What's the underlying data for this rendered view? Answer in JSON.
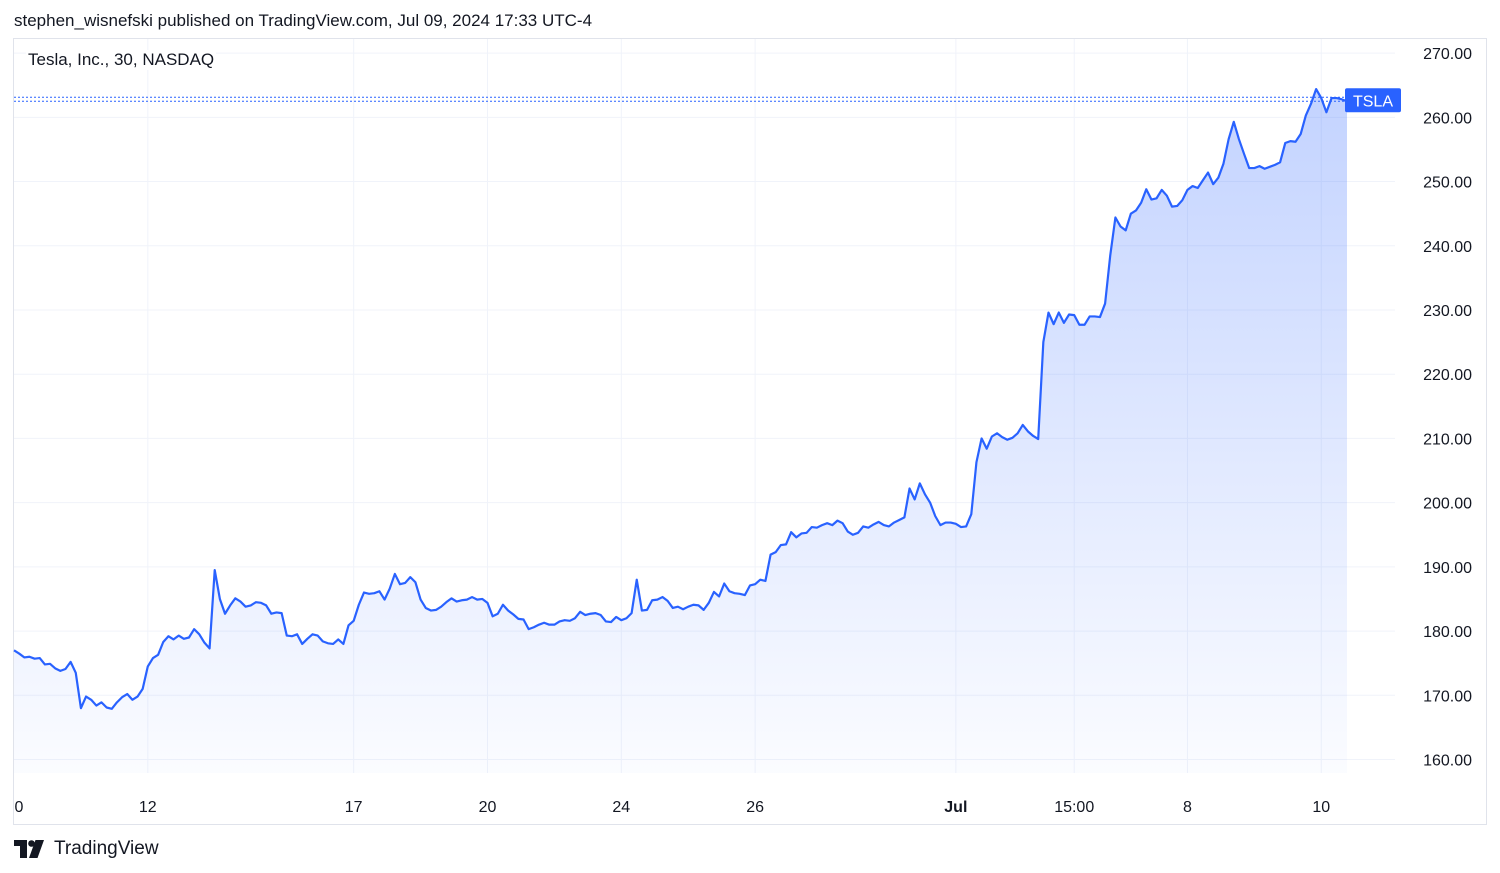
{
  "header": {
    "publish_text": "stephen_wisnefski published on TradingView.com, Jul 09, 2024 17:33 UTC-4"
  },
  "footer": {
    "brand": "TradingView"
  },
  "colors": {
    "line": "#2962ff",
    "fill_top": "#2962ff",
    "grid": "#f0f3fa",
    "badge": "#2962ff"
  },
  "chart_data": {
    "type": "area",
    "title": "Tesla, Inc., 30, NASDAQ",
    "series": [
      {
        "name": "TSLA"
      }
    ],
    "last_label": "TSLA",
    "grid": true,
    "y_axis_position": "right",
    "ylim": [
      157.9,
      272.2
    ],
    "y_ticks": [
      160,
      170,
      180,
      190,
      200,
      210,
      220,
      230,
      240,
      250,
      260,
      270
    ],
    "y_tick_labels": [
      "160.00",
      "170.00",
      "180.00",
      "190.00",
      "200.00",
      "210.00",
      "220.00",
      "230.00",
      "240.00",
      "250.00",
      "260.00",
      "270.00"
    ],
    "x_ticks": [
      {
        "index": 0,
        "label": "0"
      },
      {
        "index": 26,
        "label": "12"
      },
      {
        "index": 66,
        "label": "17"
      },
      {
        "index": 92,
        "label": "20"
      },
      {
        "index": 118,
        "label": "24"
      },
      {
        "index": 144,
        "label": "26"
      },
      {
        "index": 183,
        "label": "Jul",
        "bold": true
      },
      {
        "index": 206,
        "label": "15:00"
      },
      {
        "index": 228,
        "label": "8"
      },
      {
        "index": 254,
        "label": "10"
      }
    ],
    "values": [
      177.0,
      176.5,
      175.9,
      176.0,
      175.7,
      175.8,
      174.8,
      174.9,
      174.2,
      173.8,
      174.1,
      175.2,
      173.5,
      168.0,
      169.8,
      169.3,
      168.4,
      168.9,
      168.1,
      167.9,
      168.9,
      169.7,
      170.2,
      169.3,
      169.8,
      171.0,
      174.5,
      175.8,
      176.3,
      178.3,
      179.2,
      178.7,
      179.3,
      178.8,
      179.0,
      180.3,
      179.5,
      178.2,
      177.3,
      189.5,
      185.0,
      182.7,
      184.0,
      185.1,
      184.6,
      183.8,
      184.0,
      184.5,
      184.4,
      184.0,
      182.7,
      182.9,
      182.8,
      179.3,
      179.2,
      179.5,
      178.0,
      178.8,
      179.5,
      179.3,
      178.4,
      178.1,
      178.0,
      178.7,
      178.0,
      180.9,
      181.6,
      184.1,
      186.0,
      185.8,
      185.9,
      186.2,
      184.9,
      186.6,
      188.9,
      187.3,
      187.5,
      188.4,
      187.6,
      184.9,
      183.6,
      183.2,
      183.3,
      183.8,
      184.5,
      185.1,
      184.6,
      184.8,
      184.9,
      185.3,
      184.9,
      185.0,
      184.4,
      182.3,
      182.7,
      184.1,
      183.2,
      182.6,
      181.9,
      181.8,
      180.3,
      180.6,
      181.0,
      181.3,
      181.0,
      181.0,
      181.5,
      181.7,
      181.6,
      182.0,
      183.0,
      182.5,
      182.7,
      182.8,
      182.5,
      181.5,
      181.4,
      182.2,
      181.7,
      182.0,
      182.8,
      188.0,
      183.2,
      183.3,
      184.8,
      184.9,
      185.3,
      184.7,
      183.6,
      183.8,
      183.4,
      183.8,
      184.1,
      184.0,
      183.3,
      184.4,
      186.1,
      185.4,
      187.4,
      186.2,
      185.9,
      185.8,
      185.6,
      187.1,
      187.3,
      188.0,
      187.8,
      191.9,
      192.3,
      193.4,
      193.5,
      195.4,
      194.6,
      195.2,
      195.3,
      196.2,
      196.1,
      196.5,
      196.8,
      196.5,
      197.2,
      196.8,
      195.5,
      195.0,
      195.3,
      196.3,
      196.1,
      196.6,
      197.0,
      196.5,
      196.3,
      196.9,
      197.3,
      197.7,
      202.2,
      200.5,
      203.0,
      201.3,
      200.0,
      197.9,
      196.5,
      196.9,
      196.9,
      196.7,
      196.2,
      196.3,
      198.2,
      206.3,
      210.0,
      208.4,
      210.3,
      210.8,
      210.2,
      209.8,
      210.1,
      210.8,
      212.1,
      211.1,
      210.4,
      209.9,
      225.0,
      229.6,
      227.8,
      229.6,
      228.0,
      229.3,
      229.2,
      227.7,
      227.7,
      229.0,
      229.0,
      228.9,
      231.0,
      238.5,
      244.4,
      243.0,
      242.4,
      245.0,
      245.5,
      246.7,
      248.8,
      247.2,
      247.4,
      248.7,
      247.8,
      246.1,
      246.2,
      247.1,
      248.7,
      249.3,
      249.0,
      250.2,
      251.4,
      249.6,
      250.6,
      252.8,
      256.6,
      259.3,
      256.6,
      254.3,
      252.1,
      252.1,
      252.4,
      252.0,
      252.3,
      252.6,
      253.0,
      256.0,
      256.3,
      256.2,
      257.4,
      260.3,
      262.1,
      264.4,
      263.0,
      260.8,
      263.0,
      263.0,
      262.8,
      262.5
    ]
  }
}
